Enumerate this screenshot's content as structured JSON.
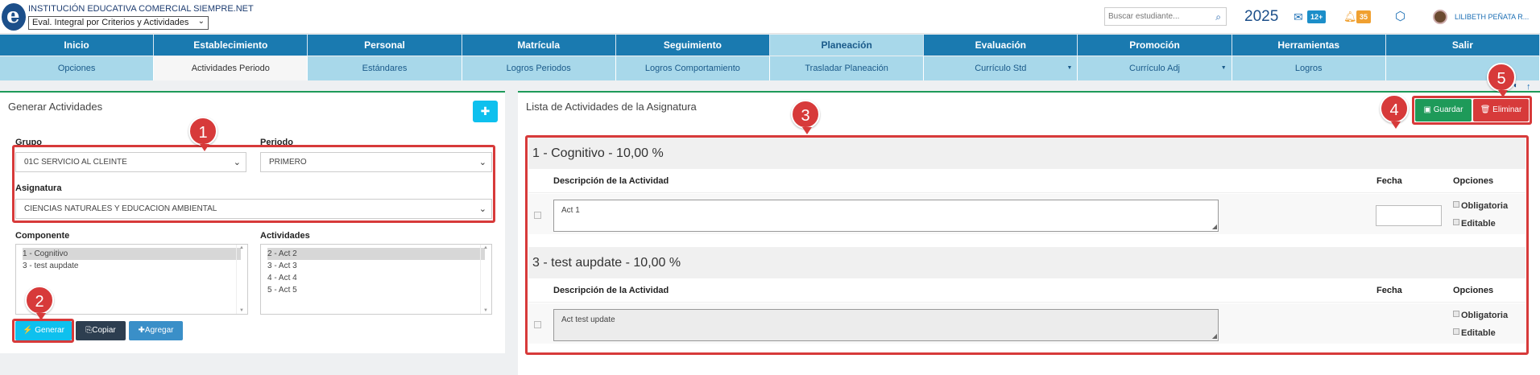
{
  "header": {
    "institution": "INSTITUCIÓN EDUCATIVA COMERCIAL SIEMPRE.NET",
    "eval_select": "Eval. Integral por Criterios y Actividades",
    "search_placeholder": "Buscar estudiante...",
    "year": "2025",
    "messages_count": "12+",
    "notifications_count": "35",
    "user_name": "LILIBETH PEÑATA R..."
  },
  "nav": {
    "main": [
      "Inicio",
      "Establecimiento",
      "Personal",
      "Matrícula",
      "Seguimiento",
      "Planeación",
      "Evaluación",
      "Promoción",
      "Herramientas",
      "Salir"
    ],
    "main_active": "Planeación",
    "sub": [
      "Opciones",
      "Actividades Periodo",
      "Estándares",
      "Logros Periodos",
      "Logros Comportamiento",
      "Trasladar Planeación",
      "Currículo Std",
      "Currículo Adj",
      "Logros",
      ""
    ],
    "sub_active": "Actividades Periodo"
  },
  "left_panel": {
    "title": "Generar Actividades",
    "grupo_label": "Grupo",
    "grupo_value": "01C SERVICIO AL CLEINTE",
    "periodo_label": "Periodo",
    "periodo_value": "PRIMERO",
    "asignatura_label": "Asignatura",
    "asignatura_value": "CIENCIAS NATURALES Y EDUCACION AMBIENTAL",
    "componente_label": "Componente",
    "componentes": [
      "1 - Cognitivo",
      "3 - test aupdate"
    ],
    "actividades_label": "Actividades",
    "actividades": [
      "2 - Act 2",
      "3 - Act 3",
      "4 - Act 4",
      "5 - Act 5"
    ],
    "btn_generar": "Generar",
    "btn_copiar": "Copiar",
    "btn_agregar": "Agregar"
  },
  "right_panel": {
    "title": "Lista de Actividades de la Asignatura",
    "btn_guardar": "Guardar",
    "btn_eliminar": "Eliminar",
    "col_desc": "Descripción de la Actividad",
    "col_fecha": "Fecha",
    "col_opciones": "Opciones",
    "opt_obligatoria": "Obligatoria",
    "opt_editable": "Editable",
    "sections": [
      {
        "title": "1 - Cognitivo - 10,00 %",
        "activity": "Act 1"
      },
      {
        "title": "3 - test aupdate - 10,00 %",
        "activity": "Act test update"
      }
    ]
  },
  "markers": [
    "1",
    "2",
    "3",
    "4",
    "5"
  ],
  "colors": {
    "nav": "#1a7ab0",
    "nav_sub": "#a8d8ea",
    "accent_green": "#1e9a59",
    "marker_red": "#d73a3a",
    "cyan": "#0ec0ee"
  }
}
